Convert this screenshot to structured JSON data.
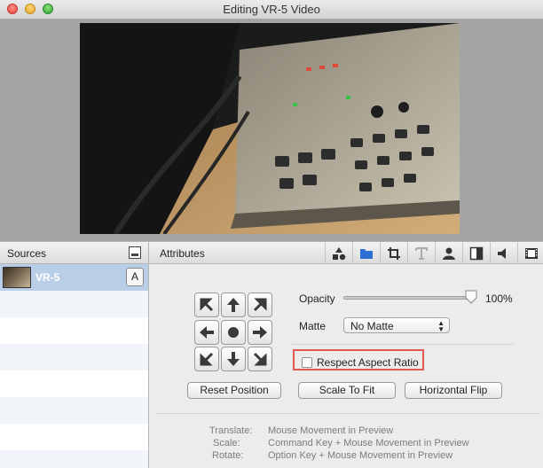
{
  "window": {
    "title": "Editing VR-5 Video"
  },
  "sources": {
    "header": "Sources",
    "items": [
      {
        "label": "VR-5",
        "badge": "A"
      }
    ]
  },
  "attributes": {
    "header": "Attributes",
    "tabs": [
      "shapes-icon",
      "folder-icon",
      "crop-icon",
      "text-icon",
      "person-icon",
      "split-panel-icon",
      "speaker-icon",
      "film-icon"
    ],
    "active_tab": 1,
    "opacity_label": "Opacity",
    "opacity_value": "100%",
    "opacity_fraction": 1.0,
    "matte_label": "Matte",
    "matte_value": "No Matte",
    "respect_aspect_label": "Respect Aspect Ratio",
    "respect_aspect_checked": false,
    "buttons": {
      "reset": "Reset Position",
      "scale": "Scale To Fit",
      "flip": "Horizontal Flip"
    },
    "help": [
      {
        "key": "Translate:",
        "value": "Mouse Movement in Preview"
      },
      {
        "key": "Scale:",
        "value": "Command Key + Mouse Movement in Preview"
      },
      {
        "key": "Rotate:",
        "value": "Option Key + Mouse Movement in Preview"
      }
    ]
  },
  "colors": {
    "accent": "#2a6fd1",
    "highlight": "#e0584f",
    "selected_row": "#b9cfe8"
  }
}
